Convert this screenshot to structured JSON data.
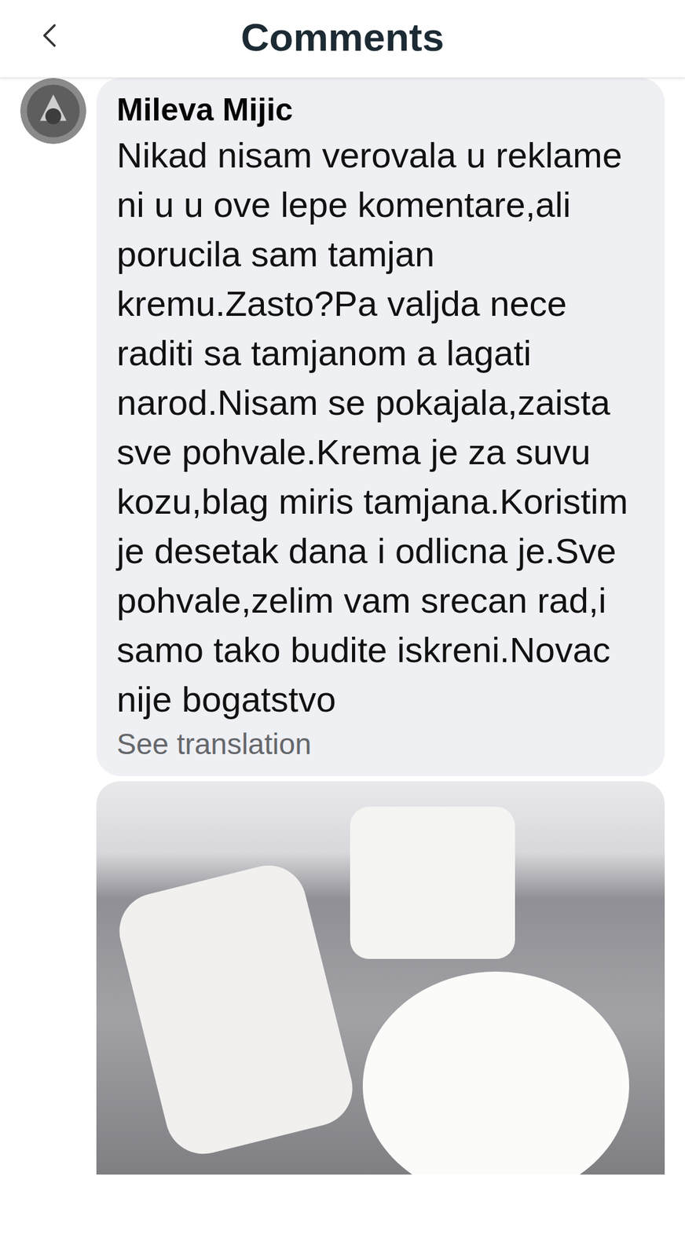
{
  "header": {
    "title": "Comments"
  },
  "comments": [
    {
      "author": "Mileva Mijic",
      "text": "Nikad nisam verovala u reklame ni u u ove lepe komentare,ali porucila sam tamjan kremu.Zasto?Pa valjda nece raditi sa tamjanom a lagati narod.Nisam se pokajala,zaista sve pohvale.Krema je za suvu kozu,blag miris tamjana.Koristim je desetak dana i odlicna je.Sve pohvale,zelim vam srecan rad,i samo tako budite iskreni.Novac nije bogatstvo",
      "translate": "See translation",
      "has_photo": true
    }
  ]
}
